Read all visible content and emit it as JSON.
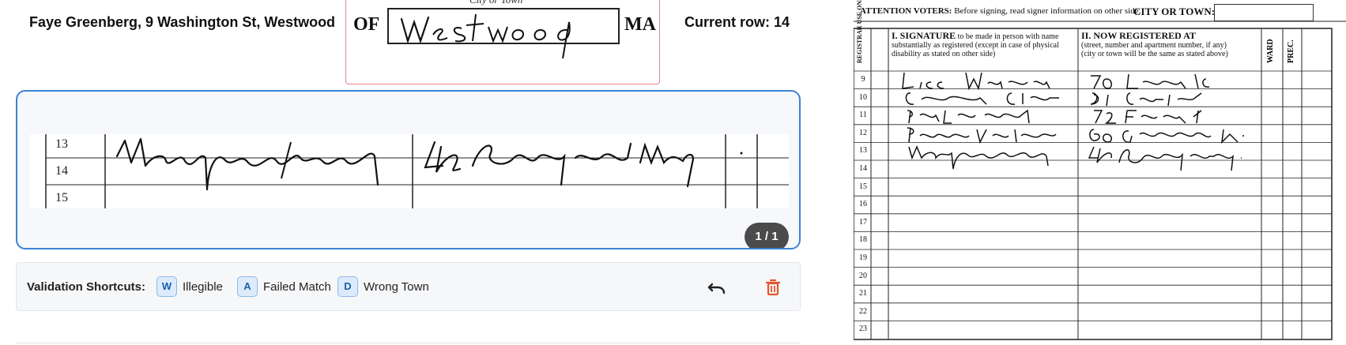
{
  "header": {
    "voter": "Faye Greenberg, 9 Washington St, Westwood",
    "current_row": "Current row: 14"
  },
  "town_crop": {
    "city_label": "City or Town",
    "of": "OF",
    "town_handwritten": "Westwood",
    "ma": "MA"
  },
  "crop": {
    "rows": [
      "13",
      "14",
      "15"
    ],
    "signature_handwritten": "Marjorie Berkowitz",
    "address_handwritten": "43 Reynolds Farm Way",
    "counter": "1 / 1"
  },
  "shortcuts": {
    "title": "Validation Shortcuts:",
    "items": [
      {
        "key": "W",
        "label": "Illegible"
      },
      {
        "key": "A",
        "label": "Failed Match"
      },
      {
        "key": "D",
        "label": "Wrong Town"
      }
    ],
    "undo_icon": "undo-icon",
    "delete_icon": "trash-icon",
    "accent": "#3b82d6",
    "delete_color": "#e4572e"
  },
  "sheet": {
    "attention_bold": "ATTENTION VOTERS:",
    "attention_rest": "Before signing, read signer information on other side.",
    "city_label": "CITY OR TOWN:",
    "col_registrar": "REGISTRAR USE ONLY",
    "col1_title": "I. SIGNATURE",
    "col1_title_rest": "to be made in person with name",
    "col1_sub1": "substantially as registered (except in case of physical",
    "col1_sub2": "disability as stated on other side)",
    "col2_title": "II. NOW REGISTERED AT",
    "col2_sub1": "(street, number and apartment number, if any)",
    "col2_sub2": "(city or town will be the same as stated above)",
    "col_ward": "WARD",
    "col_prec": "PREC.",
    "rows": [
      {
        "num": "9",
        "signature": "Lisa McKeown",
        "address": "70 Lorraine Rd"
      },
      {
        "num": "10",
        "signature": "Connie Horvitz",
        "address": "81 Colburn St"
      },
      {
        "num": "11",
        "signature": "John Bradley",
        "address": "72 French St"
      },
      {
        "num": "12",
        "signature": "Pamela Venti",
        "address": "60 Greenacre Rd"
      },
      {
        "num": "13",
        "signature": "Marjorie Berkowitz",
        "address": "43 Reynolds Farm Way"
      },
      {
        "num": "14",
        "signature": "",
        "address": ""
      },
      {
        "num": "15",
        "signature": "",
        "address": ""
      },
      {
        "num": "16",
        "signature": "",
        "address": ""
      },
      {
        "num": "17",
        "signature": "",
        "address": ""
      },
      {
        "num": "18",
        "signature": "",
        "address": ""
      },
      {
        "num": "19",
        "signature": "",
        "address": ""
      },
      {
        "num": "20",
        "signature": "",
        "address": ""
      },
      {
        "num": "21",
        "signature": "",
        "address": ""
      },
      {
        "num": "22",
        "signature": "",
        "address": ""
      },
      {
        "num": "23",
        "signature": "",
        "address": ""
      }
    ]
  }
}
